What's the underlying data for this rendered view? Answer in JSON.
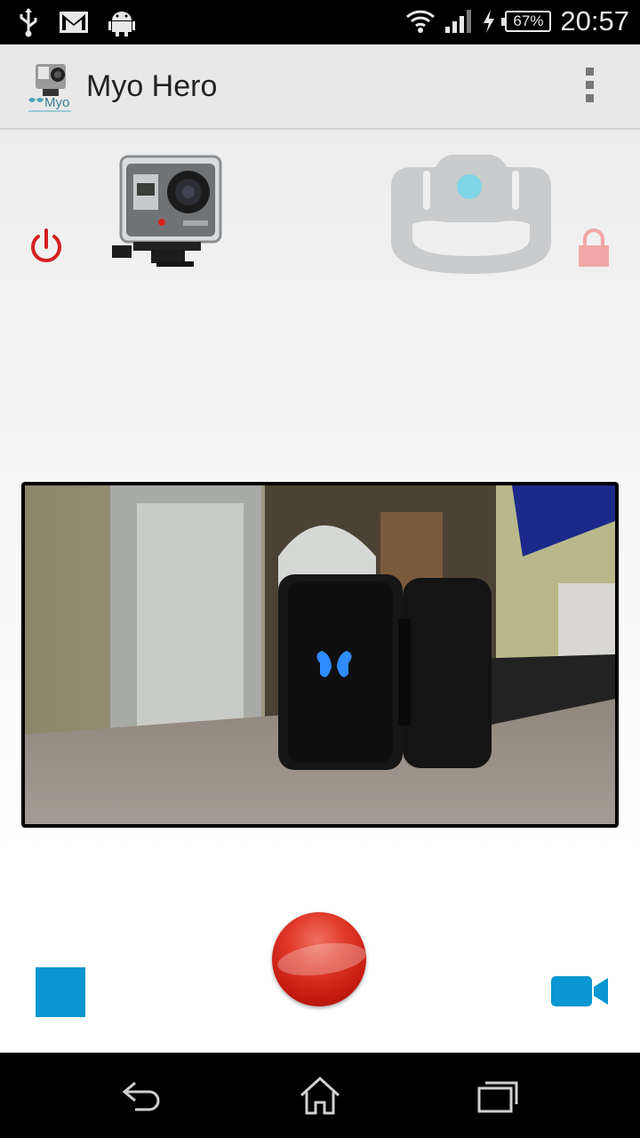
{
  "status_bar": {
    "battery_percent": "67%",
    "time": "20:57",
    "left_icons": [
      "usb-icon",
      "gmail-icon",
      "android-debug-icon"
    ],
    "right_icons": [
      "wifi-icon",
      "signal-icon",
      "charging-icon",
      "battery-icon"
    ]
  },
  "action_bar": {
    "title": "Myo Hero",
    "logo": "myo-logo-icon",
    "menu": "overflow-menu-icon"
  },
  "devices": {
    "camera": "gopro-camera-icon",
    "armband": "myo-armband-icon",
    "power_icon_color": "#d32020",
    "lock_icon_color": "#f3a6a6",
    "armband_color": "#c9cbcd",
    "armband_led_color": "#7fd6e6"
  },
  "controls": {
    "record": "record-button",
    "stop": "stop-button",
    "video_mode": "video-camera-icon",
    "accent_color": "#0a96d0",
    "record_color": "#d02218"
  },
  "nav_bar": {
    "buttons": [
      "back-icon",
      "home-icon",
      "recents-icon"
    ]
  }
}
